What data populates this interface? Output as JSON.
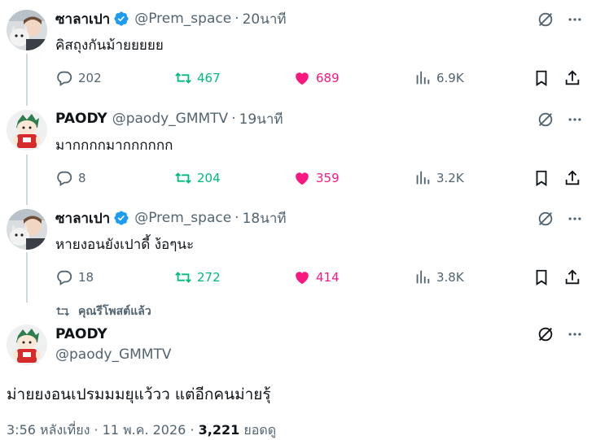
{
  "tweets": [
    {
      "name": "ซาลาเปา",
      "handle": "@Prem_space",
      "sep": "·",
      "time": "20นาที",
      "text": "คิสถุงกันม้ายยยยย",
      "verified": true,
      "avatar": "cat-selfie-avatar",
      "replies": "202",
      "retweets": "467",
      "likes": "689",
      "views": "6.9K"
    },
    {
      "name": "PAODY",
      "handle": "@paody_GMMTV",
      "sep": "·",
      "time": "19นาที",
      "text": "มากกกกมากกกกกก",
      "verified": false,
      "avatar": "cartoon-character-avatar",
      "replies": "8",
      "retweets": "204",
      "likes": "359",
      "views": "3.2K"
    },
    {
      "name": "ซาลาเปา",
      "handle": "@Prem_space",
      "sep": "·",
      "time": "18นาที",
      "text": "หายงอนยังเปาดี้ ง้อๆนะ",
      "verified": true,
      "avatar": "cat-selfie-avatar",
      "replies": "18",
      "retweets": "272",
      "likes": "414",
      "views": "3.8K"
    }
  ],
  "repost_label": "คุณรีโพสต์แล้ว",
  "main": {
    "name": "PAODY",
    "handle": "@paody_GMMTV",
    "text": "ม่ายยงอนเปรมมมยุแว้วว แต่อีกคนม่ายรุ้",
    "time": "3:56 หลังเที่ยง",
    "sep1": "·",
    "date": "11 พ.ค. 2026",
    "sep2": "·",
    "views_count": "3,221",
    "views_label": "ยอดดู"
  },
  "colors": {
    "retweet": "#00ba7c",
    "like": "#f91880",
    "verified": "#1d9bf0",
    "secondary": "#536471"
  }
}
